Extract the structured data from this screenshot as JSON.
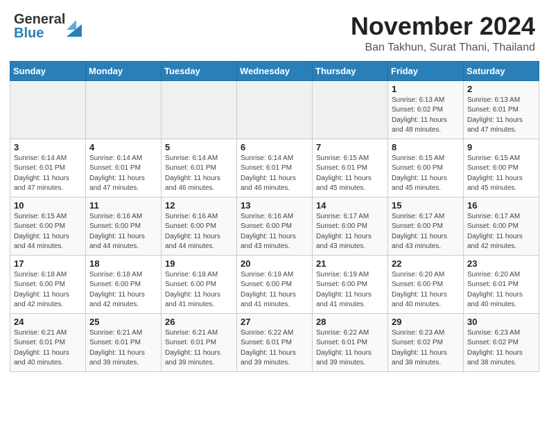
{
  "header": {
    "logo_general": "General",
    "logo_blue": "Blue",
    "month": "November 2024",
    "location": "Ban Takhun, Surat Thani, Thailand"
  },
  "weekdays": [
    "Sunday",
    "Monday",
    "Tuesday",
    "Wednesday",
    "Thursday",
    "Friday",
    "Saturday"
  ],
  "weeks": [
    [
      {
        "day": "",
        "detail": ""
      },
      {
        "day": "",
        "detail": ""
      },
      {
        "day": "",
        "detail": ""
      },
      {
        "day": "",
        "detail": ""
      },
      {
        "day": "",
        "detail": ""
      },
      {
        "day": "1",
        "detail": "Sunrise: 6:13 AM\nSunset: 6:02 PM\nDaylight: 11 hours\nand 48 minutes."
      },
      {
        "day": "2",
        "detail": "Sunrise: 6:13 AM\nSunset: 6:01 PM\nDaylight: 11 hours\nand 47 minutes."
      }
    ],
    [
      {
        "day": "3",
        "detail": "Sunrise: 6:14 AM\nSunset: 6:01 PM\nDaylight: 11 hours\nand 47 minutes."
      },
      {
        "day": "4",
        "detail": "Sunrise: 6:14 AM\nSunset: 6:01 PM\nDaylight: 11 hours\nand 47 minutes."
      },
      {
        "day": "5",
        "detail": "Sunrise: 6:14 AM\nSunset: 6:01 PM\nDaylight: 11 hours\nand 46 minutes."
      },
      {
        "day": "6",
        "detail": "Sunrise: 6:14 AM\nSunset: 6:01 PM\nDaylight: 11 hours\nand 46 minutes."
      },
      {
        "day": "7",
        "detail": "Sunrise: 6:15 AM\nSunset: 6:01 PM\nDaylight: 11 hours\nand 45 minutes."
      },
      {
        "day": "8",
        "detail": "Sunrise: 6:15 AM\nSunset: 6:00 PM\nDaylight: 11 hours\nand 45 minutes."
      },
      {
        "day": "9",
        "detail": "Sunrise: 6:15 AM\nSunset: 6:00 PM\nDaylight: 11 hours\nand 45 minutes."
      }
    ],
    [
      {
        "day": "10",
        "detail": "Sunrise: 6:15 AM\nSunset: 6:00 PM\nDaylight: 11 hours\nand 44 minutes."
      },
      {
        "day": "11",
        "detail": "Sunrise: 6:16 AM\nSunset: 6:00 PM\nDaylight: 11 hours\nand 44 minutes."
      },
      {
        "day": "12",
        "detail": "Sunrise: 6:16 AM\nSunset: 6:00 PM\nDaylight: 11 hours\nand 44 minutes."
      },
      {
        "day": "13",
        "detail": "Sunrise: 6:16 AM\nSunset: 6:00 PM\nDaylight: 11 hours\nand 43 minutes."
      },
      {
        "day": "14",
        "detail": "Sunrise: 6:17 AM\nSunset: 6:00 PM\nDaylight: 11 hours\nand 43 minutes."
      },
      {
        "day": "15",
        "detail": "Sunrise: 6:17 AM\nSunset: 6:00 PM\nDaylight: 11 hours\nand 43 minutes."
      },
      {
        "day": "16",
        "detail": "Sunrise: 6:17 AM\nSunset: 6:00 PM\nDaylight: 11 hours\nand 42 minutes."
      }
    ],
    [
      {
        "day": "17",
        "detail": "Sunrise: 6:18 AM\nSunset: 6:00 PM\nDaylight: 11 hours\nand 42 minutes."
      },
      {
        "day": "18",
        "detail": "Sunrise: 6:18 AM\nSunset: 6:00 PM\nDaylight: 11 hours\nand 42 minutes."
      },
      {
        "day": "19",
        "detail": "Sunrise: 6:18 AM\nSunset: 6:00 PM\nDaylight: 11 hours\nand 41 minutes."
      },
      {
        "day": "20",
        "detail": "Sunrise: 6:19 AM\nSunset: 6:00 PM\nDaylight: 11 hours\nand 41 minutes."
      },
      {
        "day": "21",
        "detail": "Sunrise: 6:19 AM\nSunset: 6:00 PM\nDaylight: 11 hours\nand 41 minutes."
      },
      {
        "day": "22",
        "detail": "Sunrise: 6:20 AM\nSunset: 6:00 PM\nDaylight: 11 hours\nand 40 minutes."
      },
      {
        "day": "23",
        "detail": "Sunrise: 6:20 AM\nSunset: 6:01 PM\nDaylight: 11 hours\nand 40 minutes."
      }
    ],
    [
      {
        "day": "24",
        "detail": "Sunrise: 6:21 AM\nSunset: 6:01 PM\nDaylight: 11 hours\nand 40 minutes."
      },
      {
        "day": "25",
        "detail": "Sunrise: 6:21 AM\nSunset: 6:01 PM\nDaylight: 11 hours\nand 39 minutes."
      },
      {
        "day": "26",
        "detail": "Sunrise: 6:21 AM\nSunset: 6:01 PM\nDaylight: 11 hours\nand 39 minutes."
      },
      {
        "day": "27",
        "detail": "Sunrise: 6:22 AM\nSunset: 6:01 PM\nDaylight: 11 hours\nand 39 minutes."
      },
      {
        "day": "28",
        "detail": "Sunrise: 6:22 AM\nSunset: 6:01 PM\nDaylight: 11 hours\nand 39 minutes."
      },
      {
        "day": "29",
        "detail": "Sunrise: 6:23 AM\nSunset: 6:02 PM\nDaylight: 11 hours\nand 38 minutes."
      },
      {
        "day": "30",
        "detail": "Sunrise: 6:23 AM\nSunset: 6:02 PM\nDaylight: 11 hours\nand 38 minutes."
      }
    ]
  ]
}
